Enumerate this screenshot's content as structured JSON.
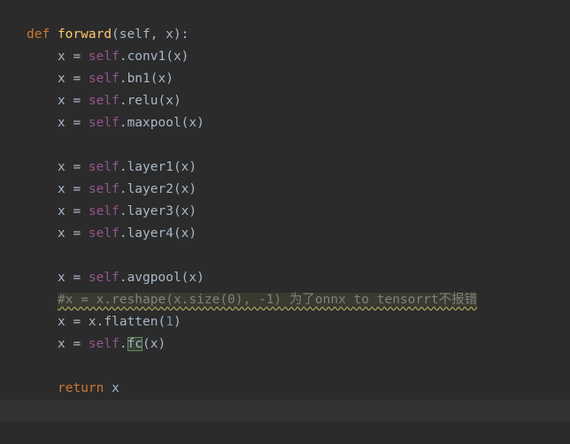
{
  "editor": {
    "lines": [
      {
        "def_kw": "def",
        "fn_name": "forward",
        "params": "(self, x):",
        "self_word": "self"
      },
      {
        "var": "x = ",
        "self": "self",
        "call": ".conv1(x)"
      },
      {
        "var": "x = ",
        "self": "self",
        "call": ".bn1(x)"
      },
      {
        "var": "x = ",
        "self": "self",
        "call": ".relu(x)"
      },
      {
        "var": "x = ",
        "self": "self",
        "call": ".maxpool(x)"
      },
      {
        "var": "x = ",
        "self": "self",
        "call": ".layer1(x)"
      },
      {
        "var": "x = ",
        "self": "self",
        "call": ".layer2(x)"
      },
      {
        "var": "x = ",
        "self": "self",
        "call": ".layer3(x)"
      },
      {
        "var": "x = ",
        "self": "self",
        "call": ".layer4(x)"
      },
      {
        "var": "x = ",
        "self": "self",
        "call": ".avgpool(x)"
      },
      {
        "comment": "#x = x.reshape(x.size(0), -1) 为了onnx to tensorrt不报错"
      },
      {
        "pre": "x = x.flatten(",
        "num": "1",
        "post": ")"
      },
      {
        "var": "x = ",
        "self": "self",
        "dot": ".",
        "highlight": "fc",
        "post": "(x)"
      },
      {
        "ret_kw": "return",
        "ret_val": " x"
      }
    ]
  }
}
